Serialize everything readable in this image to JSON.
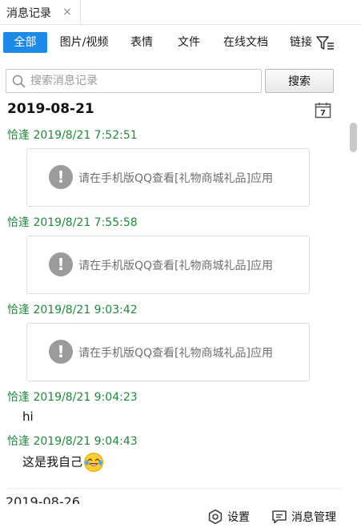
{
  "window": {
    "tab_title": "消息记录",
    "close_glyph": "×"
  },
  "categories": [
    {
      "label": "全部",
      "active": true
    },
    {
      "label": "图片/视频",
      "active": false
    },
    {
      "label": "表情",
      "active": false
    },
    {
      "label": "文件",
      "active": false
    },
    {
      "label": "在线文档",
      "active": false
    },
    {
      "label": "链接",
      "active": false
    }
  ],
  "search": {
    "placeholder": "搜索消息记录",
    "button_label": "搜索"
  },
  "date_group": {
    "date": "2019-08-21",
    "calendar_day": "7"
  },
  "messages": [
    {
      "sender": "恰逢 2019/8/21 7:52:51",
      "notice": "请在手机版QQ查看[礼物商城礼品]应用"
    },
    {
      "sender": "恰逢 2019/8/21 7:55:58",
      "notice": "请在手机版QQ查看[礼物商城礼品]应用"
    },
    {
      "sender": "恰逢 2019/8/21 9:03:42",
      "notice": "请在手机版QQ查看[礼物商城礼品]应用"
    },
    {
      "sender": "恰逢 2019/8/21 9:04:23",
      "text": "hi"
    },
    {
      "sender": "恰逢 2019/8/21 9:04:43",
      "text": "这是我自己",
      "emoji": "laughing-tears-emoji"
    }
  ],
  "next_date": "2019-08-26",
  "bottom": {
    "settings_label": "设置",
    "manage_label": "消息管理"
  },
  "colors": {
    "accent": "#1e8ae8",
    "sender": "#1f8a3b"
  }
}
